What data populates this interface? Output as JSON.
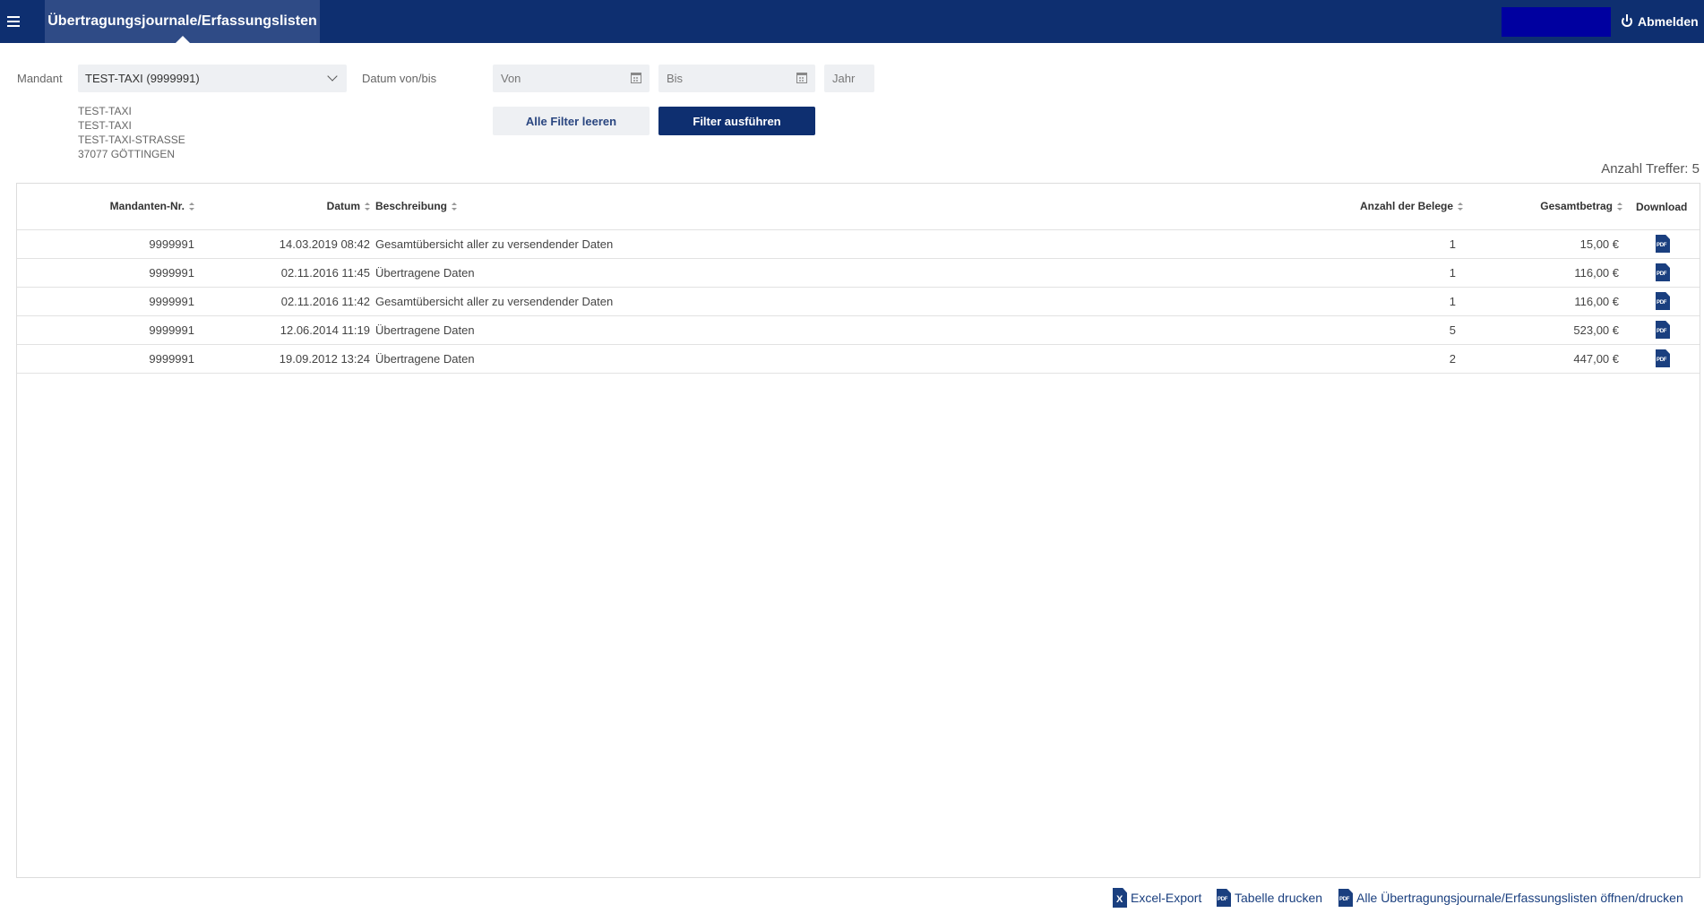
{
  "header": {
    "title": "Übertragungsjournale/Erfassungslisten",
    "logout_label": "Abmelden",
    "colors": {
      "primary": "#0e2f70",
      "active_tab": "#2f4b86",
      "user_box": "#0000a0"
    }
  },
  "filters": {
    "mandant_label": "Mandant",
    "mandant_value": "TEST-TAXI (9999991)",
    "address": [
      "TEST-TAXI",
      "TEST-TAXI",
      "TEST-TAXI-STRASSE",
      "37077 GÖTTINGEN"
    ],
    "date_label": "Datum von/bis",
    "from_placeholder": "Von",
    "to_placeholder": "Bis",
    "year_placeholder": "Jahr",
    "clear_button": "Alle Filter leeren",
    "run_button": "Filter ausführen"
  },
  "hits": "Anzahl Treffer: 5",
  "table": {
    "columns": {
      "mandant_nr": "Mandanten-Nr.",
      "datum": "Datum",
      "beschreibung": "Beschreibung",
      "anzahl": "Anzahl der Belege",
      "gesamtbetrag": "Gesamtbetrag",
      "download": "Download"
    },
    "rows": [
      {
        "mandant_nr": "9999991",
        "datum": "14.03.2019 08:42",
        "beschreibung": "Gesamtübersicht aller zu versendender Daten",
        "anzahl": "1",
        "gesamtbetrag": "15,00 €"
      },
      {
        "mandant_nr": "9999991",
        "datum": "02.11.2016 11:45",
        "beschreibung": "Übertragene Daten",
        "anzahl": "1",
        "gesamtbetrag": "116,00 €"
      },
      {
        "mandant_nr": "9999991",
        "datum": "02.11.2016 11:42",
        "beschreibung": "Gesamtübersicht aller zu versendender Daten",
        "anzahl": "1",
        "gesamtbetrag": "116,00 €"
      },
      {
        "mandant_nr": "9999991",
        "datum": "12.06.2014 11:19",
        "beschreibung": "Übertragene Daten",
        "anzahl": "5",
        "gesamtbetrag": "523,00 €"
      },
      {
        "mandant_nr": "9999991",
        "datum": "19.09.2012 13:24",
        "beschreibung": "Übertragene Daten",
        "anzahl": "2",
        "gesamtbetrag": "447,00 €"
      }
    ],
    "pdf_icon_text": "PDF"
  },
  "footer": {
    "excel_export": "Excel-Export",
    "excel_icon_text": "X",
    "print_table": "Tabelle drucken",
    "open_all": "Alle Übertragungsjournale/Erfassungslisten öffnen/drucken"
  }
}
